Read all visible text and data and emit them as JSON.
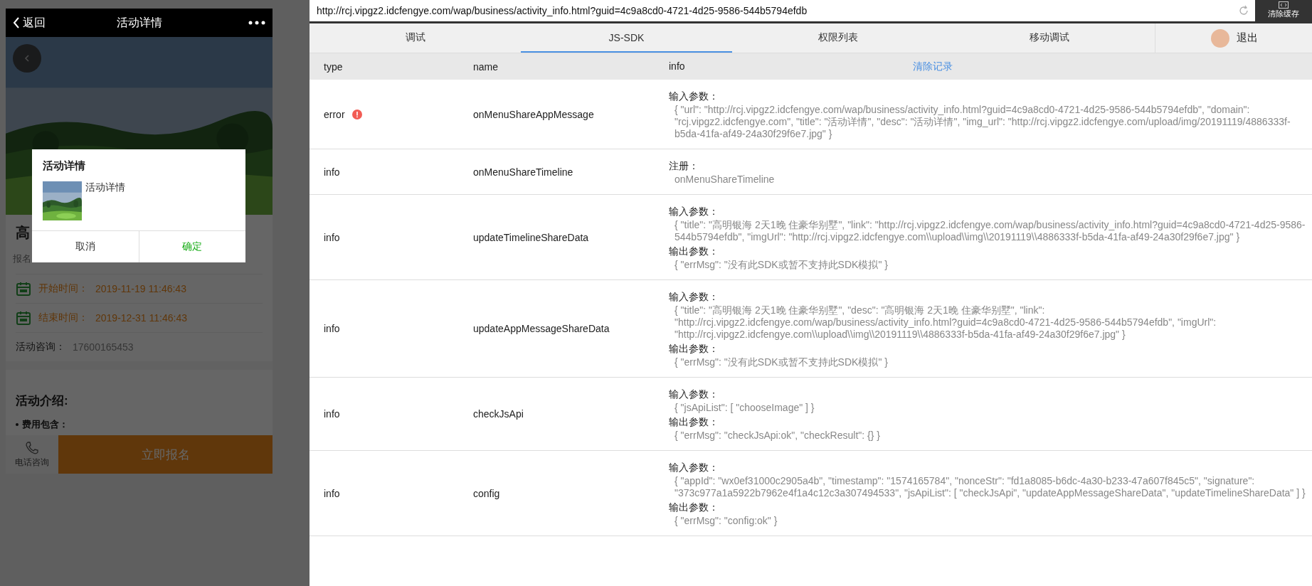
{
  "phone": {
    "nav": {
      "back": "返回",
      "title": "活动详情"
    },
    "title": "高",
    "fee_label": "报名",
    "details": [
      {
        "kind": "date",
        "label": "开始时间：",
        "value": "2019-11-19 11:46:43"
      },
      {
        "kind": "date",
        "label": "结束时间：",
        "value": "2019-12-31 11:46:43"
      },
      {
        "kind": "contact",
        "label": "活动咨询：",
        "value": "17600165453"
      }
    ],
    "intro": {
      "heading": "活动介绍:",
      "bullet": "费用包含："
    },
    "bottom_bar": {
      "phone_label": "电话咨询",
      "signup": "立即报名"
    },
    "dialog": {
      "title": "活动详情",
      "text": "活动详情",
      "buttons": [
        {
          "label": "取消",
          "kind": "cancel"
        },
        {
          "label": "确定",
          "kind": "confirm"
        }
      ]
    }
  },
  "address_bar": {
    "url": "http://rcj.vipgz2.idcfengye.com/wap/business/activity_info.html?guid=4c9a8cd0-4721-4d25-9586-544b5794efdb",
    "clear_cache": "清除缓存"
  },
  "tabs": [
    {
      "label": "调试",
      "selected": false
    },
    {
      "label": "JS-SDK",
      "selected": true
    },
    {
      "label": "权限列表",
      "selected": false
    },
    {
      "label": "移动调试",
      "selected": false
    }
  ],
  "account": {
    "logout": "退出"
  },
  "table": {
    "columns": [
      "type",
      "name",
      "info"
    ],
    "clear": "清除记录",
    "rows": [
      {
        "type": "error",
        "warning": true,
        "name": "onMenuShareAppMessage",
        "info": [
          {
            "label": "输入参数：",
            "value": "{ \"url\": \"http://rcj.vipgz2.idcfengye.com/wap/business/activity_info.html?guid=4c9a8cd0-4721-4d25-9586-544b5794efdb\", \"domain\": \"rcj.vipgz2.idcfengye.com\", \"title\": \"活动详情\", \"desc\": \"活动详情\", \"img_url\": \"http://rcj.vipgz2.idcfengye.com/upload/img/20191119/4886333f-b5da-41fa-af49-24a30f29f6e7.jpg\" }"
          }
        ]
      },
      {
        "type": "info",
        "warning": false,
        "name": "onMenuShareTimeline",
        "info": [
          {
            "label": "注册：",
            "value": "onMenuShareTimeline"
          }
        ]
      },
      {
        "type": "info",
        "warning": false,
        "name": "updateTimelineShareData",
        "info": [
          {
            "label": "输入参数：",
            "value": "{ \"title\": \"高明银海 2天1晚 住豪华别墅\", \"link\": \"http://rcj.vipgz2.idcfengye.com/wap/business/activity_info.html?guid=4c9a8cd0-4721-4d25-9586-544b5794efdb\", \"imgUrl\": \"http://rcj.vipgz2.idcfengye.com\\\\upload\\\\img\\\\20191119\\\\4886333f-b5da-41fa-af49-24a30f29f6e7.jpg\" }"
          },
          {
            "label": "输出参数：",
            "value": "{ \"errMsg\": \"没有此SDK或暂不支持此SDK模拟\" }"
          }
        ]
      },
      {
        "type": "info",
        "warning": false,
        "name": "updateAppMessageShareData",
        "info": [
          {
            "label": "输入参数：",
            "value": "{ \"title\": \"高明银海 2天1晚 住豪华别墅\", \"desc\": \"高明银海 2天1晚 住豪华别墅\", \"link\": \"http://rcj.vipgz2.idcfengye.com/wap/business/activity_info.html?guid=4c9a8cd0-4721-4d25-9586-544b5794efdb\", \"imgUrl\": \"http://rcj.vipgz2.idcfengye.com\\\\upload\\\\img\\\\20191119\\\\4886333f-b5da-41fa-af49-24a30f29f6e7.jpg\" }"
          },
          {
            "label": "输出参数：",
            "value": "{ \"errMsg\": \"没有此SDK或暂不支持此SDK模拟\" }"
          }
        ]
      },
      {
        "type": "info",
        "warning": false,
        "name": "checkJsApi",
        "info": [
          {
            "label": "输入参数：",
            "value": "{ \"jsApiList\": [ \"chooseImage\" ] }"
          },
          {
            "label": "输出参数：",
            "value": "{ \"errMsg\": \"checkJsApi:ok\", \"checkResult\": {} }"
          }
        ]
      },
      {
        "type": "info",
        "warning": false,
        "name": "config",
        "info": [
          {
            "label": "输入参数：",
            "value": "{ \"appId\": \"wx0ef31000c2905a4b\", \"timestamp\": \"1574165784\", \"nonceStr\": \"fd1a8085-b6dc-4a30-b233-47a607f845c5\", \"signature\": \"373c977a1a5922b7962e4f1a4c12c3a307494533\", \"jsApiList\": [ \"checkJsApi\", \"updateAppMessageShareData\", \"updateTimelineShareData\" ] }"
          },
          {
            "label": "输出参数：",
            "value": "{ \"errMsg\": \"config:ok\" }"
          }
        ]
      }
    ]
  }
}
